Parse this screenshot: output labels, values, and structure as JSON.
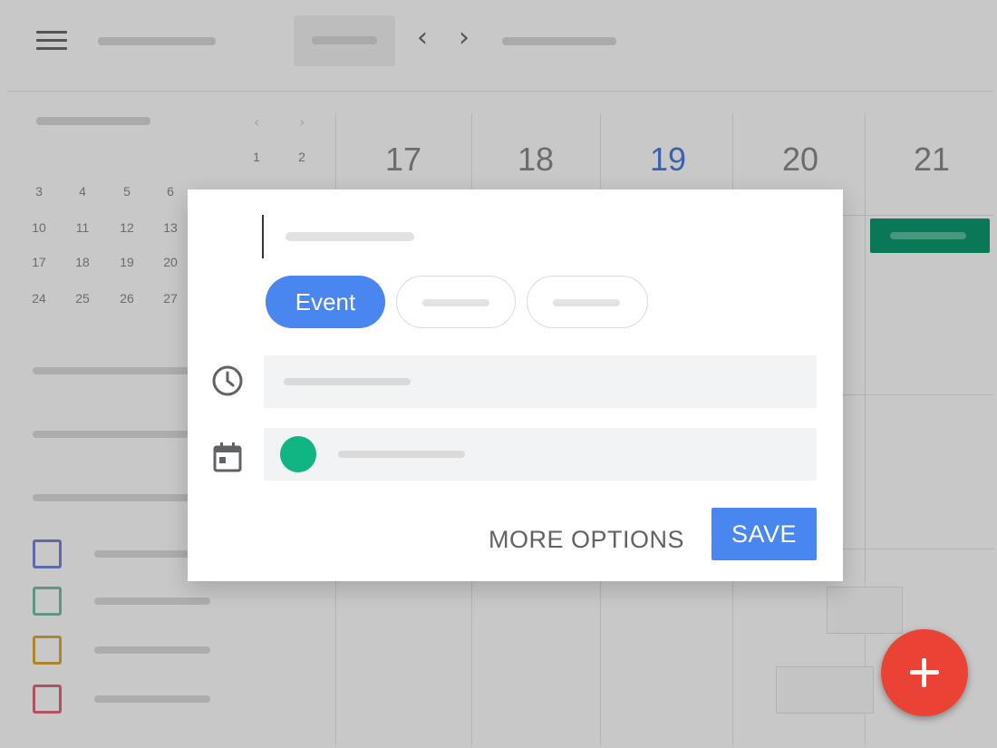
{
  "calendar": {
    "week_days": [
      "17",
      "18",
      "19",
      "20",
      "21"
    ],
    "today": "19",
    "mini_month_rows": [
      [
        "",
        "",
        "",
        "",
        "",
        "1",
        "2"
      ],
      [
        "3",
        "4",
        "5",
        "6",
        "",
        "",
        ""
      ],
      [
        "10",
        "11",
        "12",
        "13",
        "",
        "",
        ""
      ],
      [
        "17",
        "18",
        "19",
        "20",
        "",
        "",
        ""
      ],
      [
        "24",
        "25",
        "26",
        "27",
        "",
        "",
        ""
      ]
    ],
    "calendar_list_colors": [
      "#7b86d6",
      "#7bbfa8",
      "#e0a93a",
      "#e06a80"
    ],
    "event_color": "#0c9a6e"
  },
  "dialog": {
    "title_value": "",
    "type_chips": [
      {
        "label": "Event",
        "active": true
      },
      {
        "label": "",
        "active": false
      },
      {
        "label": "",
        "active": false
      }
    ],
    "time_icon": "clock-icon",
    "calendar_icon": "calendar-icon",
    "calendar_color": "#11b584",
    "more_options_label": "MORE OPTIONS",
    "save_label": "SAVE",
    "accent_color": "#4a86f0"
  },
  "fab": {
    "icon": "plus-icon",
    "color": "#ea4335"
  }
}
